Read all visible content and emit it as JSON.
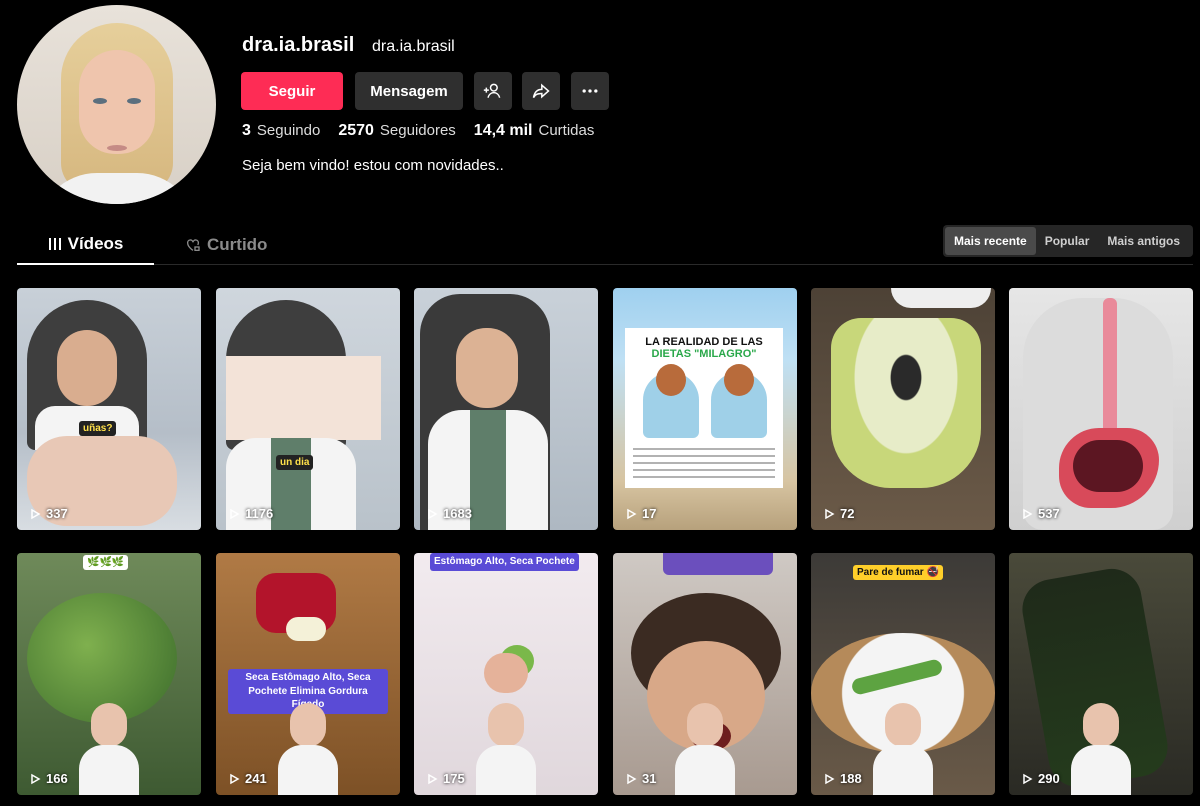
{
  "profile": {
    "username": "dra.ia.brasil",
    "handle": "dra.ia.brasil",
    "follow_label": "Seguir",
    "message_label": "Mensagem",
    "stats": [
      {
        "value": "3",
        "label": "Seguindo"
      },
      {
        "value": "2570",
        "label": "Seguidores"
      },
      {
        "value": "14,4 mil",
        "label": "Curtidas"
      }
    ],
    "bio": "Seja bem vindo! estou com novidades.."
  },
  "tabs": {
    "videos": "Vídeos",
    "liked": "Curtido"
  },
  "sort": {
    "recent": "Mais recente",
    "popular": "Popular",
    "oldest": "Mais antigos"
  },
  "videos": [
    {
      "views": "337",
      "caption": "uñas?"
    },
    {
      "views": "1176",
      "caption": "un dia"
    },
    {
      "views": "1683"
    },
    {
      "views": "17",
      "title1": "LA REALIDAD DE LAS",
      "title2": "DIETAS \"MILAGRO\""
    },
    {
      "views": "72"
    },
    {
      "views": "537"
    },
    {
      "views": "166",
      "caption": "🌿🌿🌿"
    },
    {
      "views": "241",
      "caption": "Seca Estômago Alto, Seca Pochete Elimina Gordura Fígado"
    },
    {
      "views": "175",
      "caption": "Estômago Alto, Seca Pochete"
    },
    {
      "views": "31"
    },
    {
      "views": "188",
      "caption": "Pare de fumar 🚭"
    },
    {
      "views": "290"
    }
  ],
  "colors": {
    "accent": "#fe2c55",
    "background": "#000000",
    "button": "#2f2f2f"
  }
}
